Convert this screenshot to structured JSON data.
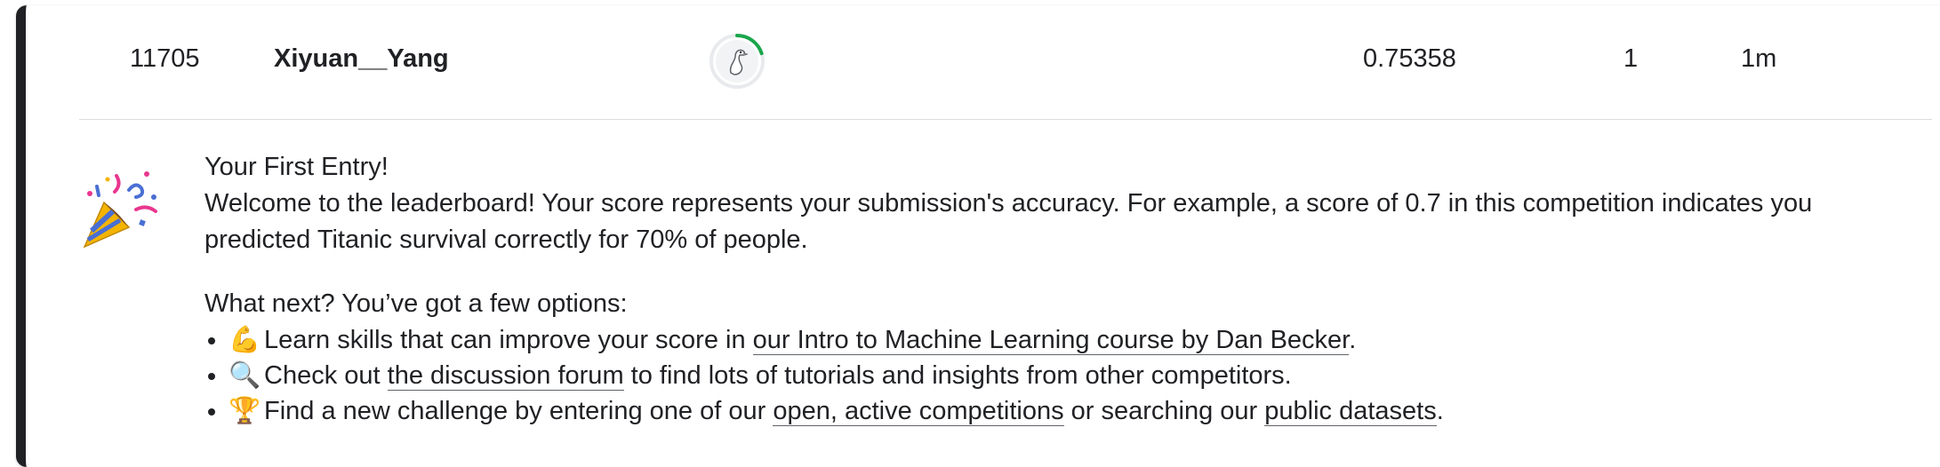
{
  "row": {
    "rank": "11705",
    "team_name": "Xiyuan__Yang",
    "score": "0.75358",
    "entries": "1",
    "last": "1m",
    "avatar_progress": 0.2
  },
  "message": {
    "title": "Your First Entry!",
    "body": "Welcome to the leaderboard! Your score represents your submission's accuracy. For example, a score of 0.7 in this competition indicates you predicted Titanic survival correctly for 70% of people.",
    "next_heading": "What next? You’ve got a few options:",
    "options": [
      {
        "emoji": "💪",
        "text_before": "Learn skills that can improve your score in ",
        "link": "our Intro to Machine Learning course by Dan Becker",
        "text_after": "."
      },
      {
        "emoji": "🔍",
        "text_before": "Check out ",
        "link": "the discussion forum",
        "text_after": " to find lots of tutorials and insights from other competitors."
      },
      {
        "emoji": "🏆",
        "text_before": "Find a new challenge by entering one of our ",
        "link": "open, active competitions",
        "text_middle": " or searching our ",
        "link2": "public datasets",
        "text_after": "."
      }
    ]
  },
  "colors": {
    "accent_bar": "#202124",
    "progress_ring": "#1aa64b",
    "divider": "#dadce0"
  }
}
